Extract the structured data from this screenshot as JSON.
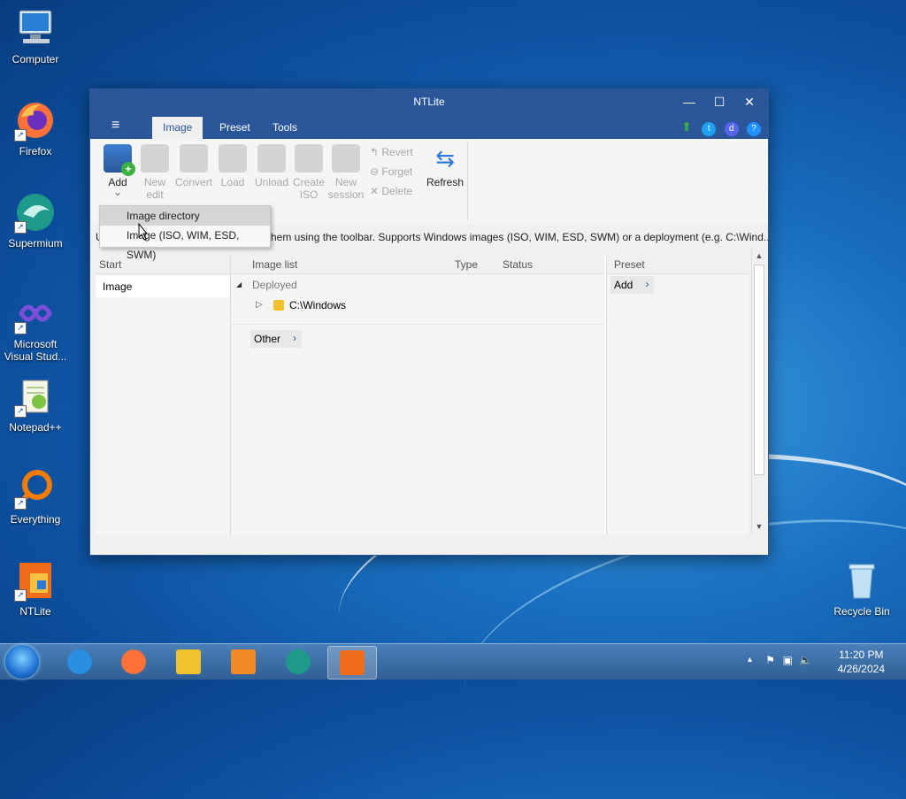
{
  "desktop": {
    "icons": [
      {
        "label": "Computer"
      },
      {
        "label": "Firefox"
      },
      {
        "label": "Supermium"
      },
      {
        "label": "Microsoft Visual Stud..."
      },
      {
        "label": "Notepad++"
      },
      {
        "label": "Everything"
      },
      {
        "label": "NTLite"
      },
      {
        "label": "Recycle Bin"
      }
    ]
  },
  "window": {
    "title": "NTLite",
    "controls": {
      "minimize": "—",
      "maximize": "☐",
      "close": "✕"
    },
    "menu_icon": "≡",
    "tabs": [
      {
        "label": "Image",
        "active": true
      },
      {
        "label": "Preset"
      },
      {
        "label": "Tools"
      }
    ],
    "toolbar": {
      "add": "Add",
      "add_arrow": "⌄",
      "new_edit": "New edit",
      "convert": "Convert",
      "load": "Load",
      "unload": "Unload",
      "create_iso": "Create ISO",
      "new_session": "New session",
      "revert": "Revert",
      "forget": "Forget",
      "delete": "Delete",
      "refresh": "Refresh"
    },
    "info_text": "them using the toolbar. Supports Windows images (ISO, WIM, ESD, SWM) or a deployment (e.g. C:\\Wind...",
    "info_prefix": "U",
    "start_pane": {
      "header": "Start",
      "items": [
        "Image"
      ]
    },
    "image_list": {
      "headers": {
        "name": "Image list",
        "type": "Type",
        "status": "Status"
      },
      "group": "Deployed",
      "entry": "C:\\Windows",
      "other": "Other"
    },
    "preset_pane": {
      "header": "Preset",
      "add": "Add"
    },
    "dropdown": {
      "items": [
        "Image directory",
        "Image (ISO, WIM, ESD, SWM)"
      ]
    }
  },
  "taskbar": {
    "time": "11:20 PM",
    "date": "4/26/2024",
    "tray_up": "▴"
  },
  "colors": {
    "accent": "#2b579a"
  }
}
